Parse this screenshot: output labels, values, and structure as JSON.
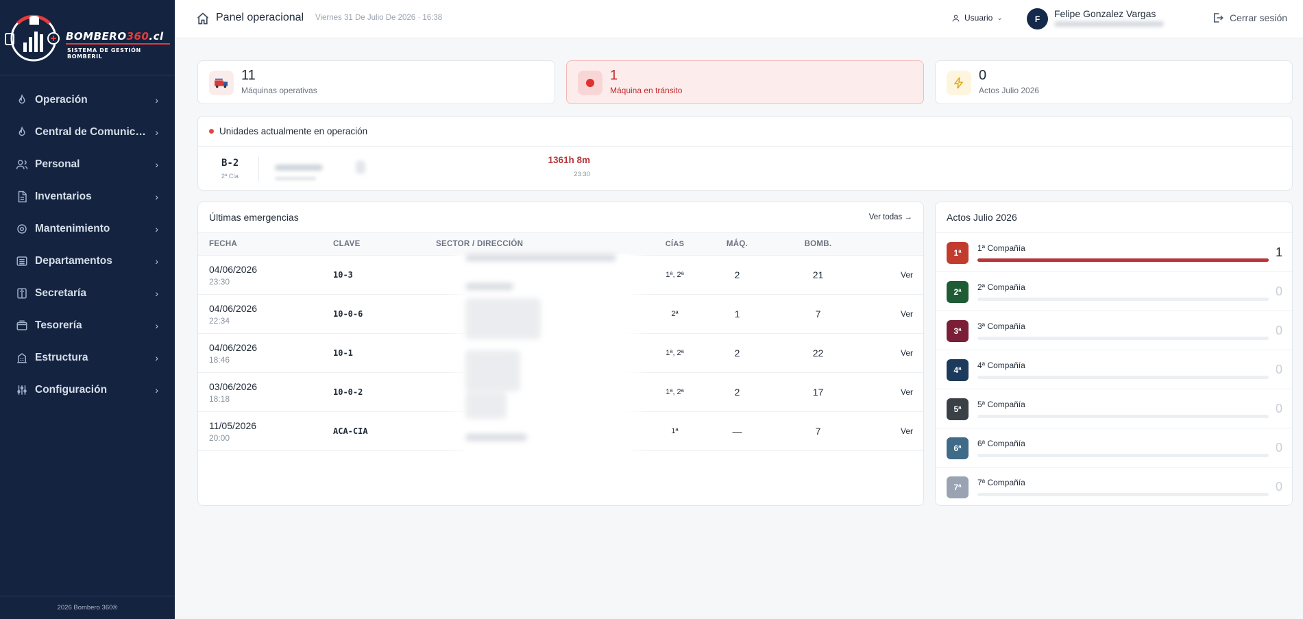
{
  "brand": {
    "name_part1": "BOMBERO",
    "name_part2": "360",
    "name_part3": ".cl",
    "subtitle": "SISTEMA DE GESTIÓN BOMBERIL",
    "accent": "#e53b3b"
  },
  "sidebar": {
    "items": [
      {
        "label": "Operación",
        "icon": "flame-icon"
      },
      {
        "label": "Central de Comunicaciones",
        "icon": "flame-icon"
      },
      {
        "label": "Personal",
        "icon": "users-icon"
      },
      {
        "label": "Inventarios",
        "icon": "document-icon"
      },
      {
        "label": "Mantenimiento",
        "icon": "gear-icon"
      },
      {
        "label": "Departamentos",
        "icon": "list-icon"
      },
      {
        "label": "Secretaría",
        "icon": "book-icon"
      },
      {
        "label": "Tesorería",
        "icon": "wallet-icon"
      },
      {
        "label": "Estructura",
        "icon": "building-icon"
      },
      {
        "label": "Configuración",
        "icon": "sliders-icon"
      }
    ],
    "footer": "2026 Bombero 360®",
    "bg_color": "#14233f"
  },
  "topbar": {
    "title": "Panel operacional",
    "date": "Viernes 31 De Julio De 2026 · 16:38",
    "user_menu": "Usuario",
    "avatar_initial": "F",
    "user_name": "Felipe Gonzalez Vargas",
    "logout": "Cerrar sesión"
  },
  "stats": [
    {
      "value": "11",
      "label": "Máquinas operativas",
      "icon": "fire-truck-icon"
    },
    {
      "value": "1",
      "label": "Máquina en tránsito",
      "icon": "record-dot-icon"
    },
    {
      "value": "0",
      "label": "Actos Julio 2026",
      "icon": "lightning-icon"
    }
  ],
  "units": {
    "title": "Unidades actualmente en operación",
    "items": [
      {
        "code": "B-2",
        "cia": "2ª Cía",
        "elapsed": "1361h 8m",
        "time": "23:30"
      }
    ]
  },
  "emergencies": {
    "title": "Últimas emergencias",
    "see_all": "Ver todas →",
    "columns": [
      "FECHA",
      "CLAVE",
      "SECTOR / DIRECCIÓN",
      "CÍAS",
      "MÁQ.",
      "BOMB."
    ],
    "rows": [
      {
        "date": "04/06/2026",
        "time": "23:30",
        "key": "10-3",
        "cias": "1ª, 2ª",
        "maq": "2",
        "bomb": "21",
        "action": "Ver"
      },
      {
        "date": "04/06/2026",
        "time": "22:34",
        "key": "10-0-6",
        "cias": "2ª",
        "maq": "1",
        "bomb": "7",
        "action": "Ver"
      },
      {
        "date": "04/06/2026",
        "time": "18:46",
        "key": "10-1",
        "cias": "1ª, 2ª",
        "maq": "2",
        "bomb": "22",
        "action": "Ver"
      },
      {
        "date": "03/06/2026",
        "time": "18:18",
        "key": "10-0-2",
        "cias": "1ª, 2ª",
        "maq": "2",
        "bomb": "17",
        "action": "Ver"
      },
      {
        "date": "11/05/2026",
        "time": "20:00",
        "key": "ACA-CIA",
        "cias": "1ª",
        "maq": "—",
        "bomb": "7",
        "action": "Ver"
      }
    ]
  },
  "acts": {
    "title": "Actos Julio 2026",
    "companies": [
      {
        "badge": "1ª",
        "name": "1ª Compañía",
        "count": "1",
        "share": 1,
        "color": "#c23b2f"
      },
      {
        "badge": "2ª",
        "name": "2ª Compañía",
        "count": "0",
        "share": 0,
        "color": "#1f5b35"
      },
      {
        "badge": "3ª",
        "name": "3ª Compañía",
        "count": "0",
        "share": 0,
        "color": "#7a1f37"
      },
      {
        "badge": "4ª",
        "name": "4ª Compañía",
        "count": "0",
        "share": 0,
        "color": "#1c3a5c"
      },
      {
        "badge": "5ª",
        "name": "5ª Compañía",
        "count": "0",
        "share": 0,
        "color": "#3b4047"
      },
      {
        "badge": "6ª",
        "name": "6ª Compañía",
        "count": "0",
        "share": 0,
        "color": "#3f6a88"
      },
      {
        "badge": "7ª",
        "name": "7ª Compañía",
        "count": "0",
        "share": 0,
        "color": "#9aa3b2"
      }
    ]
  }
}
